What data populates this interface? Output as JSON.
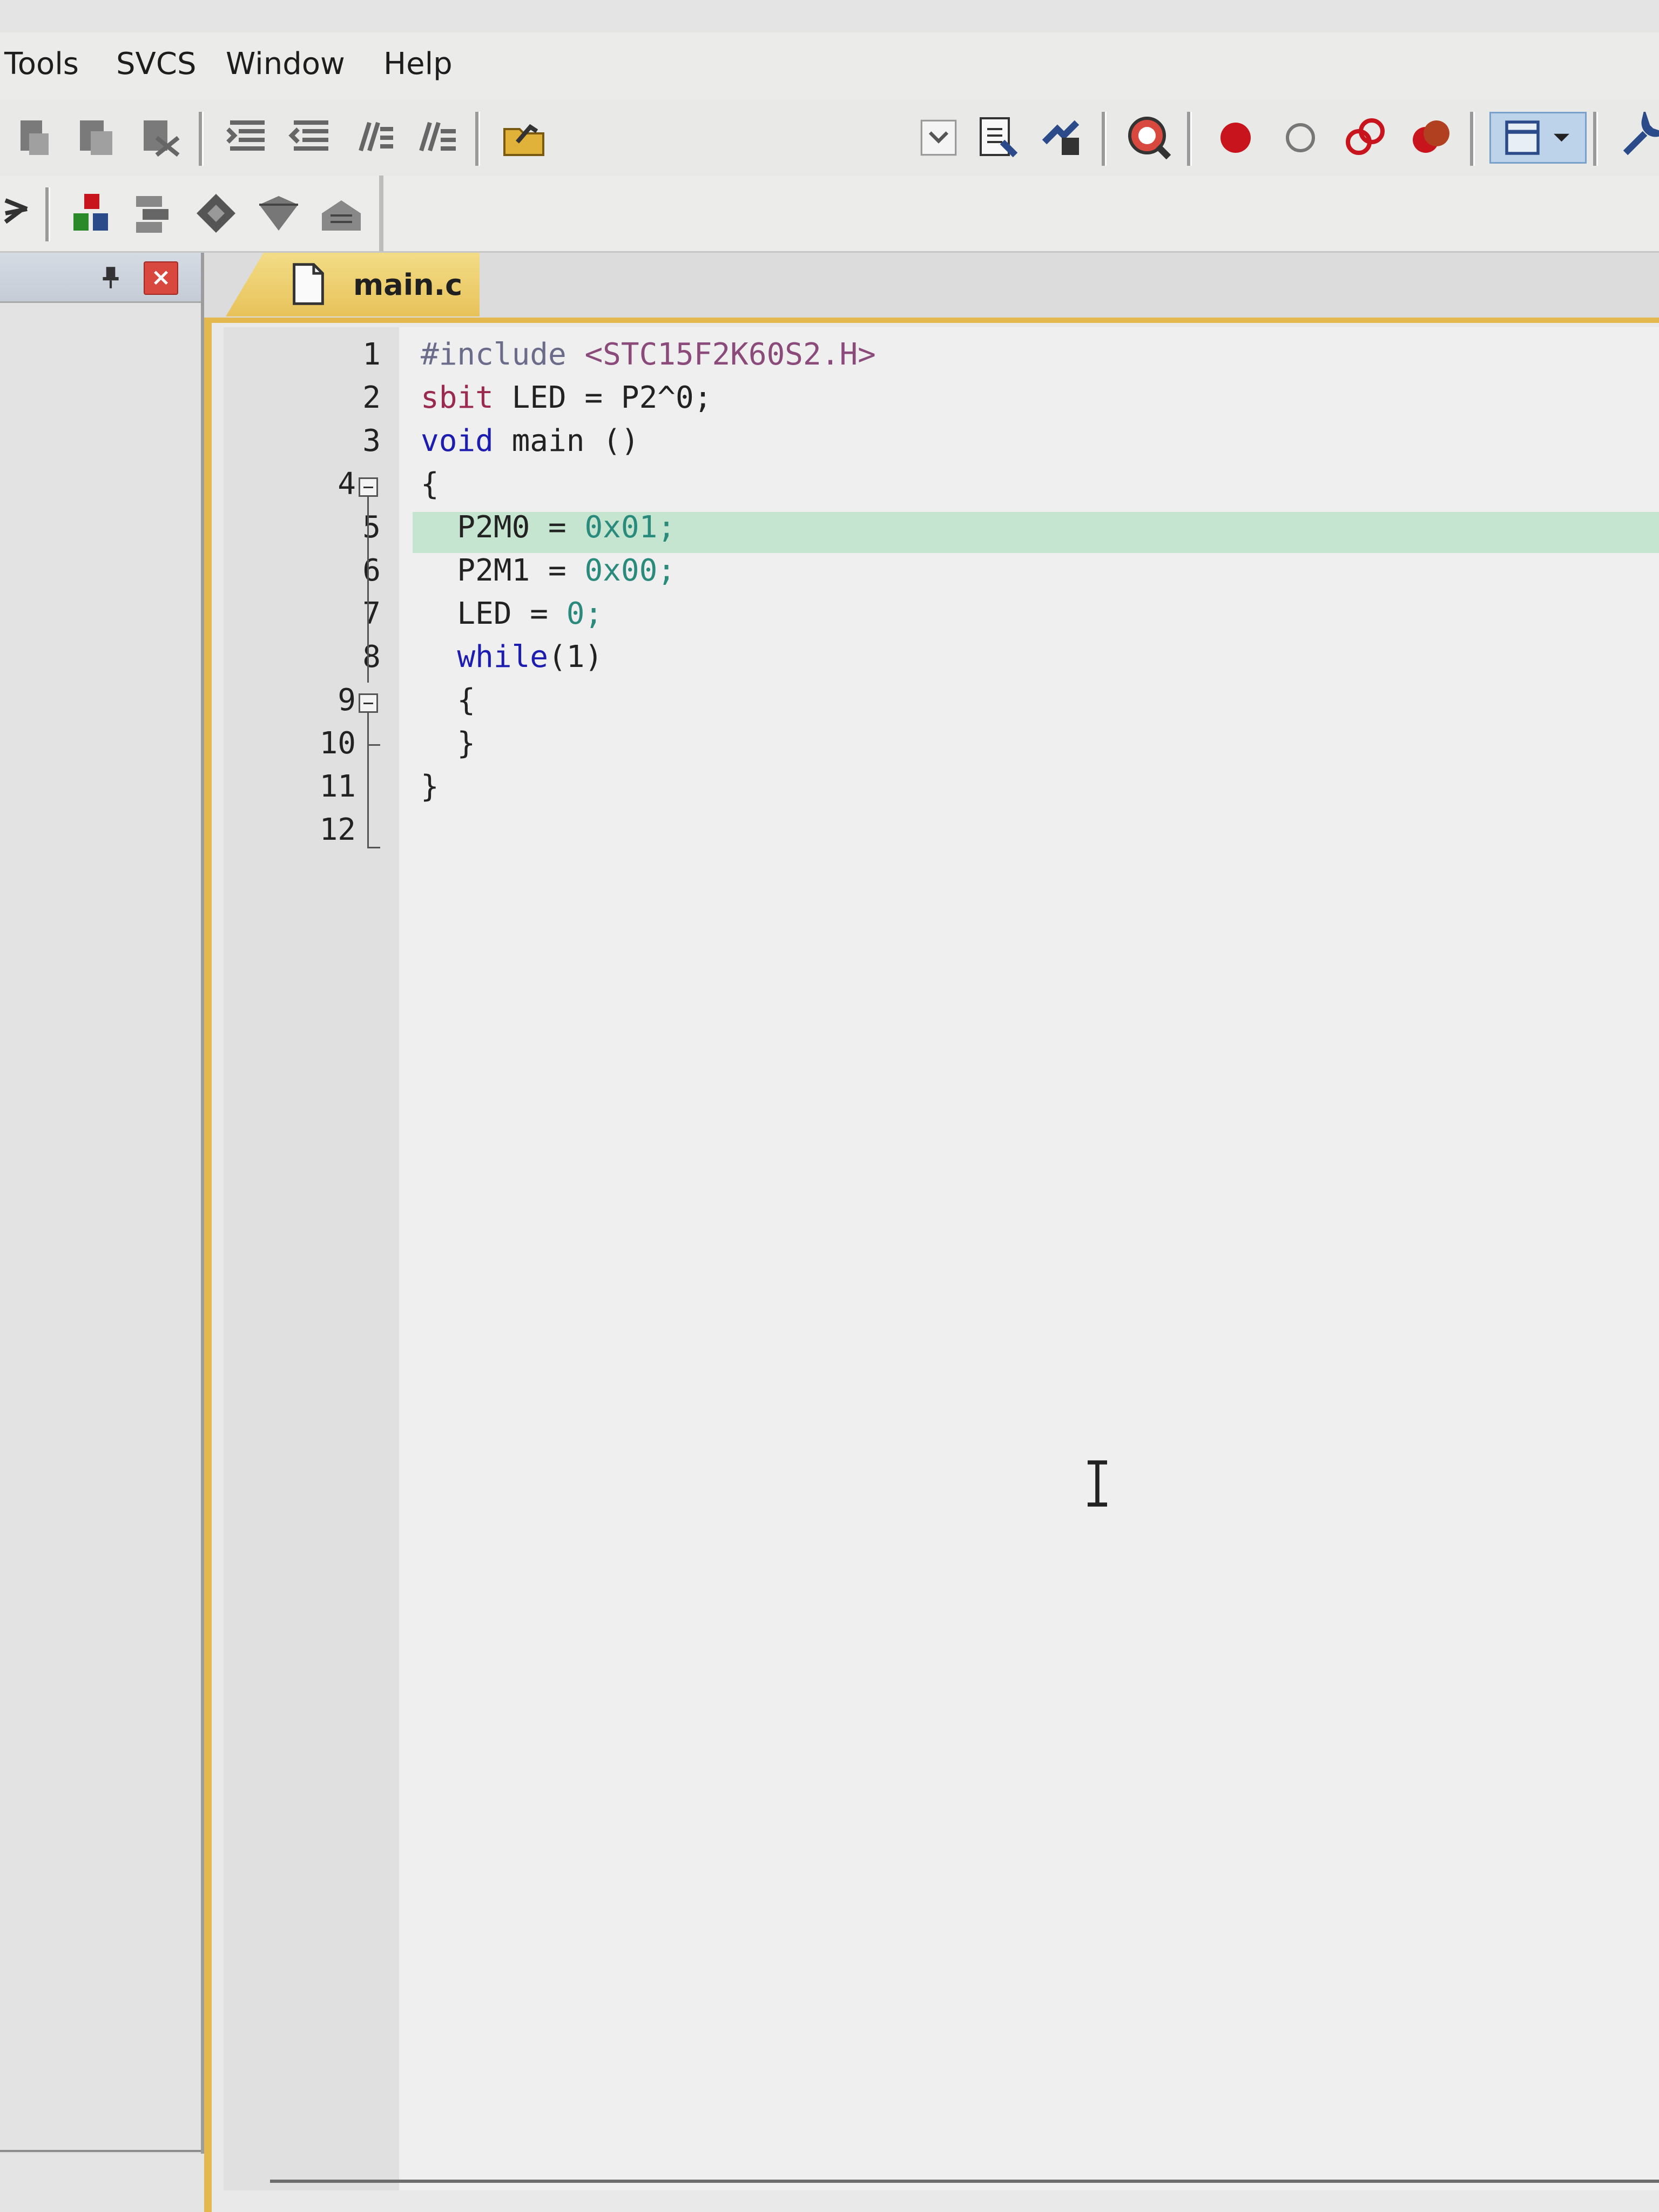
{
  "menubar": {
    "items": [
      "Tools",
      "SVCS",
      "Window",
      "Help"
    ]
  },
  "toolbar1": {
    "icons": [
      "indent-icon",
      "unindent-icon",
      "comment-icon",
      "uncomment-icon",
      "find-in-files-icon",
      "bookmark-icon",
      "dropdown-icon",
      "build-output-icon",
      "download-icon",
      "debug-session-icon",
      "breakpoint-icon",
      "breakpoint-disable-icon",
      "breakpoint-clear-icon",
      "breakpoint-kill-icon",
      "window-layout-icon",
      "configure-icon"
    ]
  },
  "toolbar2": {
    "icons": [
      "target-options-icon",
      "manage-components-icon",
      "select-packs-icon",
      "run-time-env-icon",
      "pack-installer-icon",
      "books-icon"
    ]
  },
  "project_panel": {
    "close_label": "×"
  },
  "editor": {
    "tab_label": "main.c",
    "line_numbers": [
      "1",
      "2",
      "3",
      "4",
      "5",
      "6",
      "7",
      "8",
      "9",
      "10",
      "11",
      "12"
    ],
    "lines": [
      "#include <STC15F2K60S2.H>",
      "sbit LED = P2^0;",
      "void main ()",
      "{",
      "  P2M0 = 0x01;",
      "  P2M1 = 0x00;",
      "  LED = 0;",
      "  while(1)",
      "  {",
      "  }",
      "}",
      ""
    ],
    "current_line": 5,
    "colors": {
      "preprocessor": "#6b6b8a",
      "string": "#8a4a7a",
      "keyword": "#1c1cb0",
      "number": "#2a8a7c",
      "current_line_bg": "#c5e5d0",
      "tab_active": "#e8c25a"
    }
  }
}
